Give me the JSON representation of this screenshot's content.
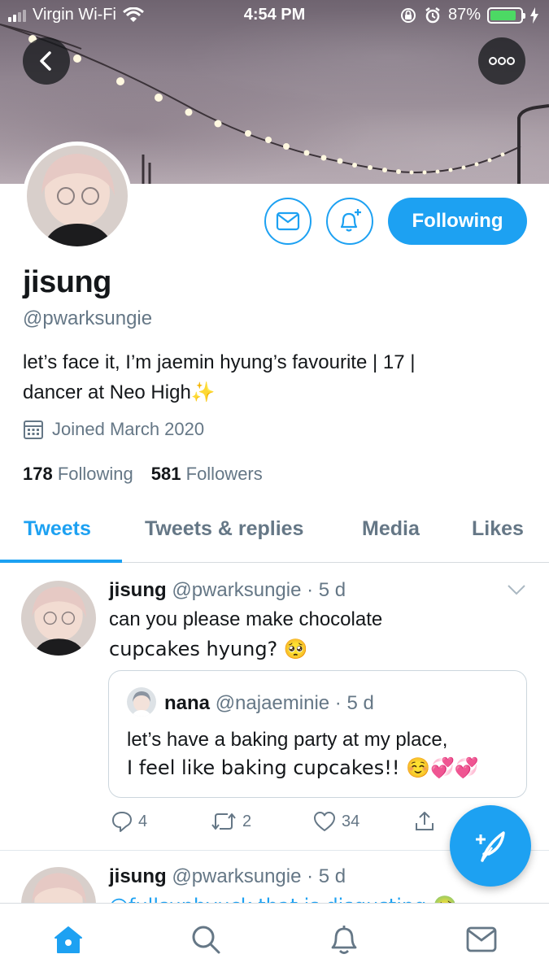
{
  "status_bar": {
    "carrier": "Virgin Wi-Fi",
    "time": "4:54 PM",
    "battery": "87%",
    "battery_level": 0.87,
    "battery_color": "#4cd964"
  },
  "profile": {
    "name": "jisung",
    "handle": "@pwarksungie",
    "bio_line1": "let’s face it, I’m jaemin hyung’s favourite | 17 |",
    "bio_line2": "dancer at Neo High",
    "bio_emoji": "✨",
    "joined": "Joined March 2020",
    "following_count": "178",
    "following_label": "Following",
    "followers_count": "581",
    "followers_label": "Followers",
    "follow_button": "Following"
  },
  "tabs": [
    {
      "label": "Tweets",
      "active": true
    },
    {
      "label": "Tweets & replies",
      "active": false
    },
    {
      "label": "Media",
      "active": false
    },
    {
      "label": "Likes",
      "active": false
    }
  ],
  "tweets": [
    {
      "name": "jisung",
      "handle": "@pwarksungie",
      "time": "5 d",
      "text_line1": "can you please make chocolate",
      "text_line2": "cupcakes hyung? 🥺",
      "quote": {
        "name": "nana",
        "handle": "@najaeminie",
        "time": "5 d",
        "text_line1": "let’s have a baking party at my place,",
        "text_line2": "I feel like baking cupcakes!! ☺️💞💞"
      },
      "replies": "4",
      "retweets": "2",
      "likes": "34"
    },
    {
      "name": "jisung",
      "handle": "@pwarksungie",
      "time": "5 d",
      "text_partial": "@fullsunhyuck that is disgusting 🤢"
    }
  ],
  "icons": {
    "back": "back-arrow-icon",
    "more": "more-icon",
    "message": "envelope-icon",
    "notify": "bell-plus-icon",
    "calendar": "calendar-icon",
    "reply": "reply-icon",
    "retweet": "retweet-icon",
    "like": "heart-icon",
    "share": "share-icon",
    "compose": "compose-tweet-icon",
    "home": "home-icon",
    "search": "search-icon",
    "notifications": "bell-icon",
    "messages": "mail-icon"
  },
  "colors": {
    "accent": "#1da1f2",
    "text": "#14171a",
    "secondary": "#657786"
  }
}
